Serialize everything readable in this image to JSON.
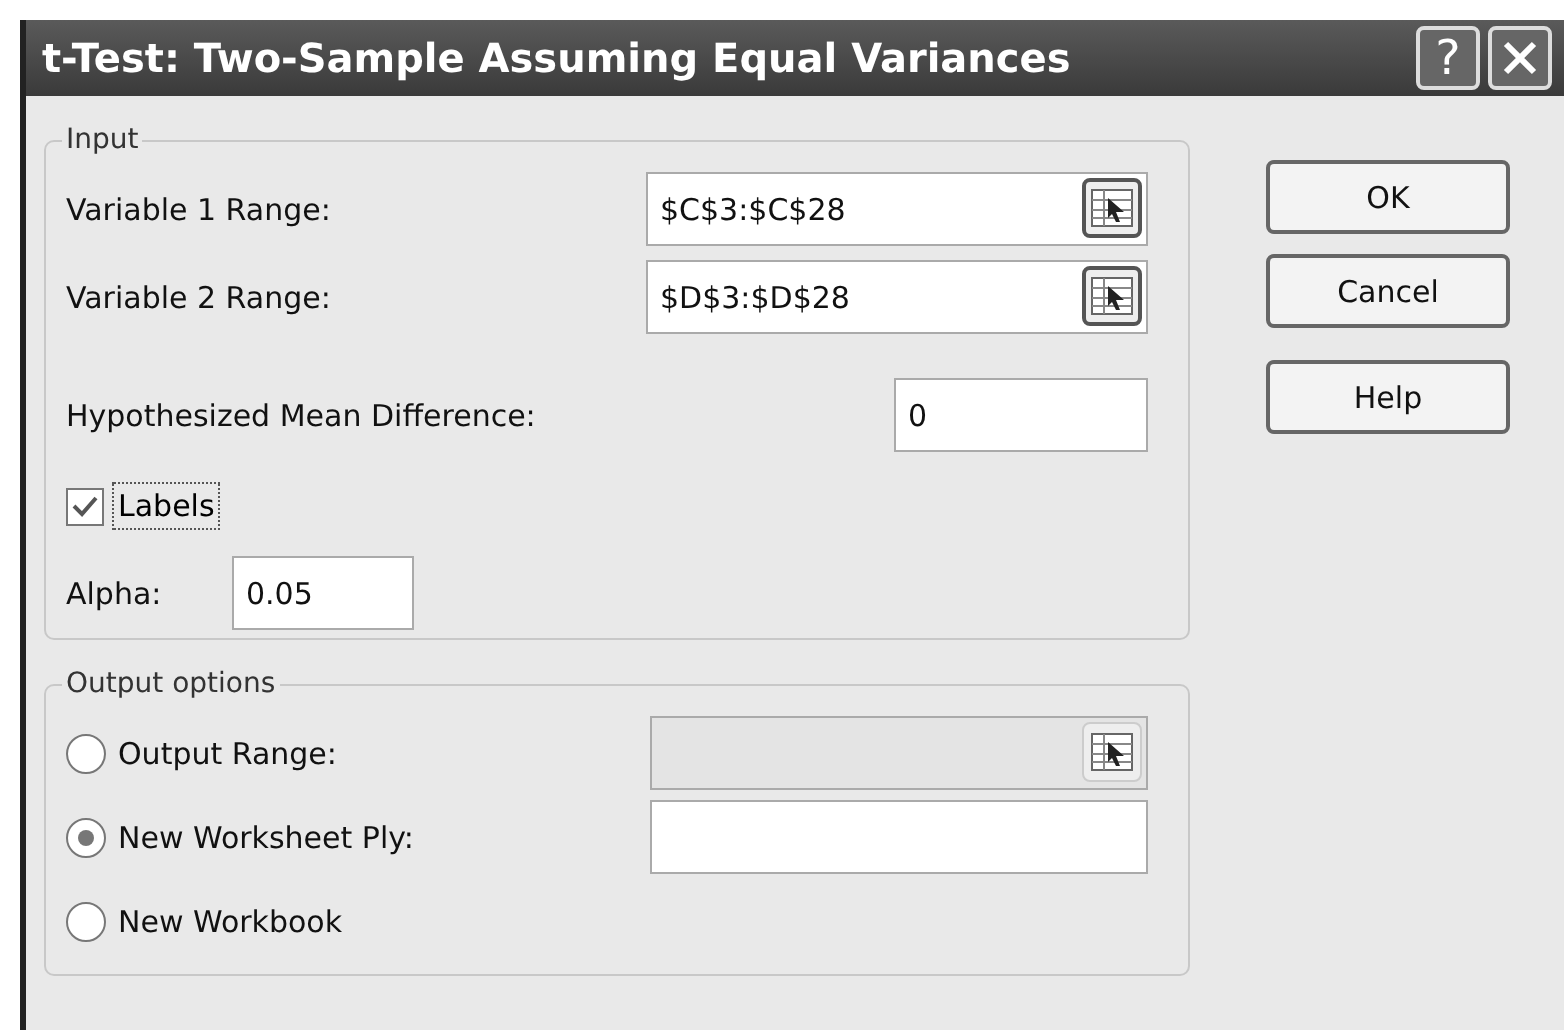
{
  "window": {
    "title": "t-Test: Two-Sample Assuming Equal Variances",
    "help_button": "?"
  },
  "input_group": {
    "legend": "Input",
    "fields": [
      {
        "kind": "range",
        "label": "Variable 1 Range:",
        "value": "$C$3:$C$28"
      },
      {
        "kind": "range",
        "label": "Variable 2 Range:",
        "value": "$D$3:$D$28"
      },
      {
        "kind": "text",
        "label": "Hypothesized Mean Difference:",
        "value": "0"
      }
    ],
    "labels_checkbox": {
      "label": "Labels",
      "checked": true
    },
    "alpha": {
      "label": "Alpha:",
      "value": "0.05"
    }
  },
  "output_group": {
    "legend": "Output options",
    "options": [
      {
        "kind": "range",
        "label": "Output Range:",
        "selected": false,
        "disabled": true
      },
      {
        "kind": "text",
        "label": "New Worksheet Ply:",
        "selected": true,
        "disabled": false
      },
      {
        "kind": "plain",
        "label": "New Workbook",
        "selected": false
      }
    ]
  },
  "buttons": [
    "OK",
    "Cancel",
    "Help"
  ]
}
